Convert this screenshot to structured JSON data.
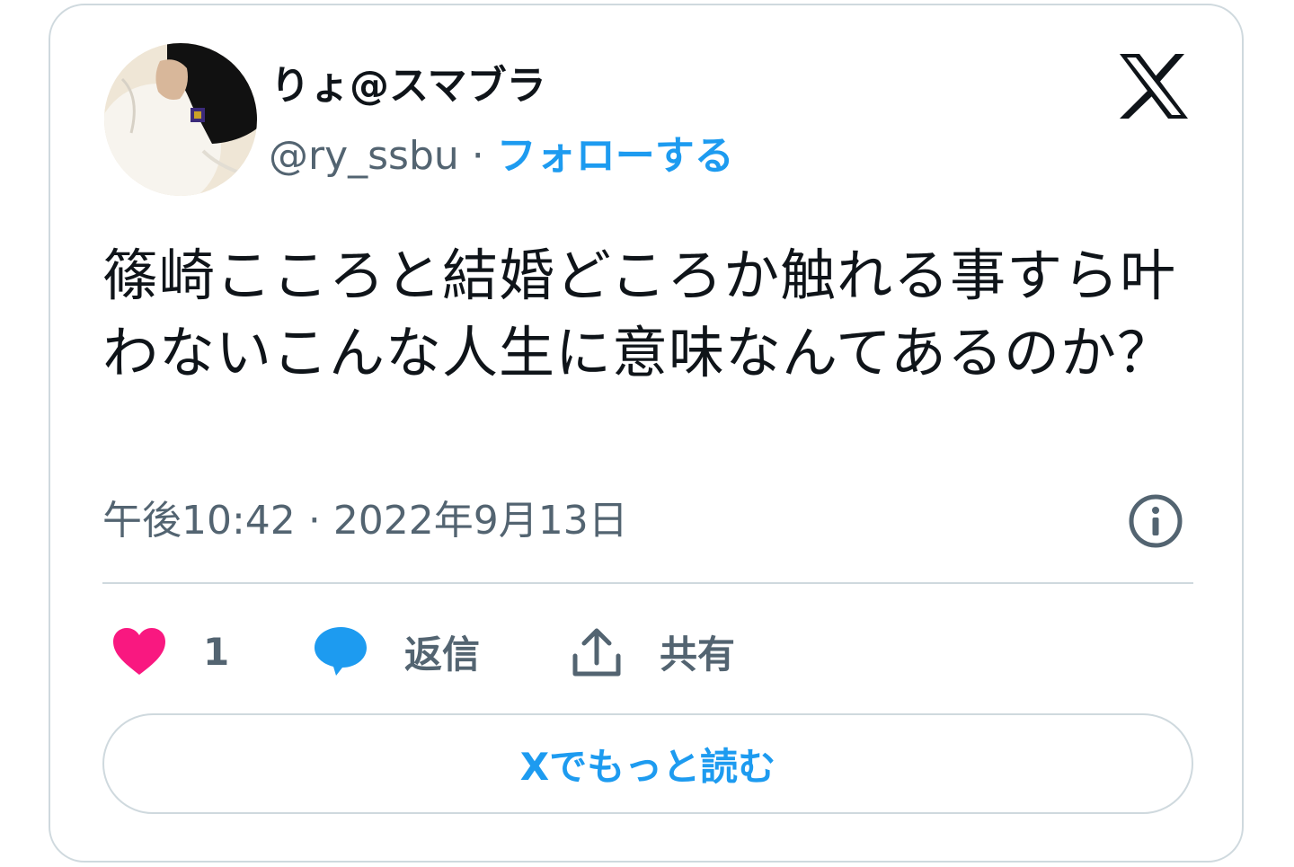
{
  "tweet": {
    "display_name": "りょ@スマブラ",
    "handle": "@ry_ssbu",
    "separator": "·",
    "follow_label": "フォローする",
    "text": "篠崎こころと結婚どころか触れる事すら叶わないこんな人生に意味なんてあるのか？",
    "time": "午後10:42",
    "date": "2022年9月13日"
  },
  "actions": {
    "likes_count": "1",
    "reply_label": "返信",
    "share_label": "共有"
  },
  "read_more_label": "Xでもっと読む",
  "icons": {
    "logo": "x-logo-icon",
    "info": "info-icon",
    "like": "heart-icon",
    "reply": "speech-bubble-icon",
    "share": "share-upload-icon"
  },
  "colors": {
    "accent": "#1d9bf0",
    "like": "#f91880",
    "secondary_text": "#536471",
    "border": "#cfd9de"
  }
}
